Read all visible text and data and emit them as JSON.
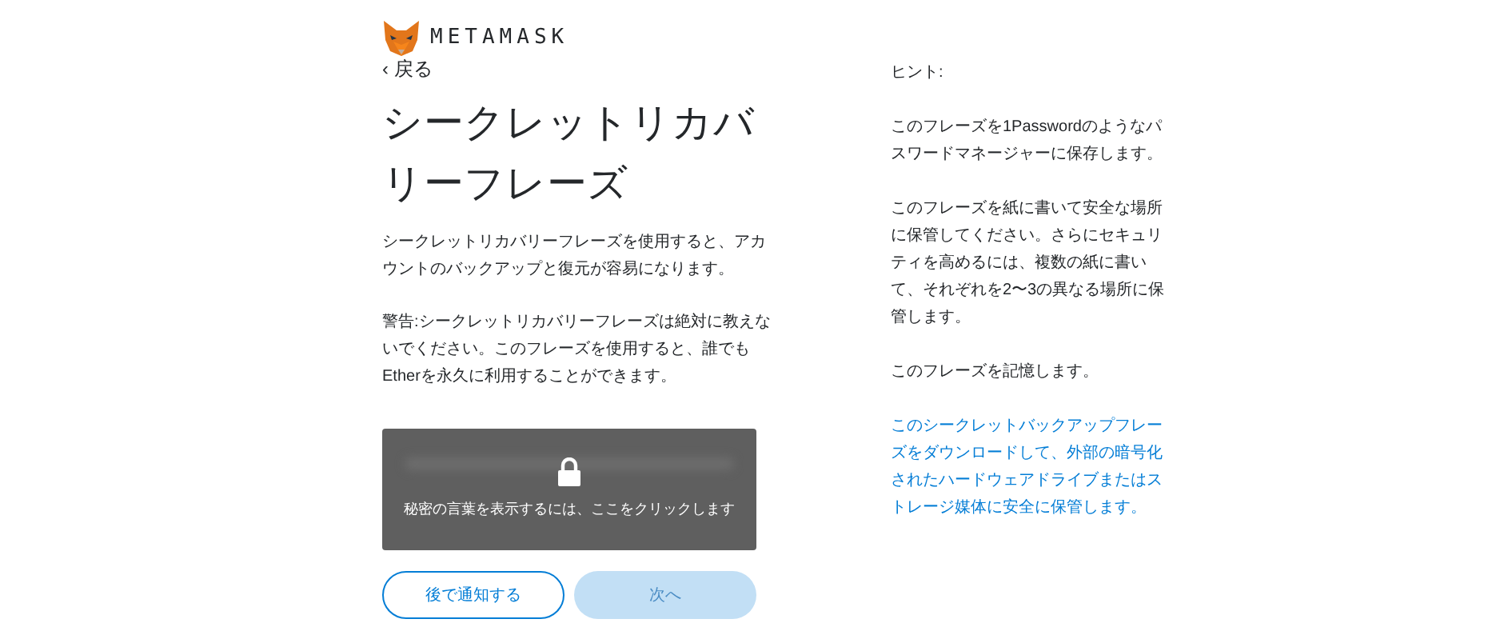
{
  "brand": {
    "name": "METAMASK"
  },
  "back_link": "‹ 戻る",
  "title": "シークレットリカバリーフレーズ",
  "paragraphs": [
    "シークレットリカバリーフレーズを使用すると、アカウントのバックアップと復元が容易になります。",
    "警告:シークレットリカバリーフレーズは絶対に教えないでください。このフレーズを使用すると、誰でもEtherを永久に利用することができます。"
  ],
  "reveal": {
    "label": "秘密の言葉を表示するには、ここをクリックします",
    "revealed": false
  },
  "buttons": [
    {
      "label": "後で通知する",
      "kind": "secondary",
      "disabled": false
    },
    {
      "label": "次へ",
      "kind": "primary",
      "disabled": true
    }
  ],
  "hints": {
    "title": "ヒント:",
    "items": [
      {
        "text": "このフレーズを1Passwordのようなパスワードマネージャーに保存します。",
        "kind": "text"
      },
      {
        "text": "このフレーズを紙に書いて安全な場所に保管してください。さらにセキュリティを高めるには、複数の紙に書いて、それぞれを2〜3の異なる場所に保管します。",
        "kind": "text"
      },
      {
        "text": "このフレーズを記憶します。",
        "kind": "text"
      },
      {
        "text": "このシークレットバックアップフレーズをダウンロードして、外部の暗号化されたハードウェアドライブまたはストレージ媒体に安全に保管します。",
        "kind": "link"
      }
    ]
  }
}
